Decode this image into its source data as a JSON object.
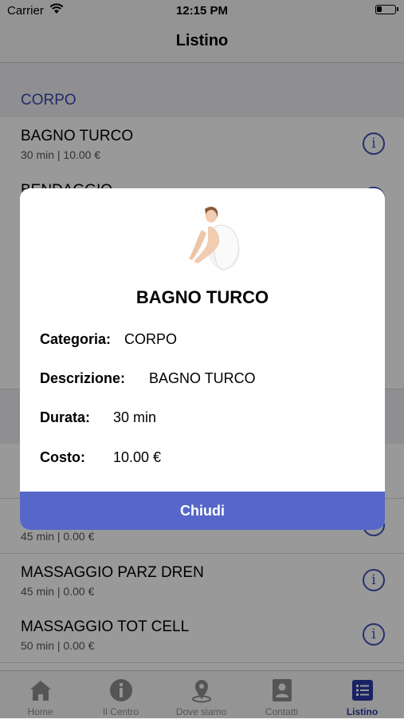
{
  "status_bar": {
    "carrier": "Carrier",
    "time": "12:15 PM"
  },
  "navbar": {
    "title": "Listino"
  },
  "section": {
    "title": "CORPO"
  },
  "rows": [
    {
      "name": "BAGNO TURCO",
      "sub": "30 min | 10.00 €"
    },
    {
      "name": "BENDAGGIO",
      "sub": ""
    },
    {
      "name": "",
      "sub": "45 min | 0.00 €"
    },
    {
      "name": "MASSAGGIO PARZ DREN",
      "sub": "45 min | 0.00 €"
    },
    {
      "name": "MASSAGGIO TOT CELL",
      "sub": "50 min | 0.00 €"
    }
  ],
  "tabs": [
    {
      "label": "Home",
      "icon": "home-icon"
    },
    {
      "label": "Il Centro",
      "icon": "info-icon"
    },
    {
      "label": "Dove siamo",
      "icon": "map-pin-icon"
    },
    {
      "label": "Contatti",
      "icon": "contact-card-icon"
    },
    {
      "label": "Listino",
      "icon": "list-icon"
    }
  ],
  "dialog": {
    "title": "BAGNO TURCO",
    "categoria_label": "Categoria:",
    "categoria_value": "CORPO",
    "descrizione_label": "Descrizione:",
    "descrizione_value": "BAGNO TURCO",
    "durata_label": "Durata:",
    "durata_value": "30 min",
    "costo_label": "Costo:",
    "costo_value": "10.00 €",
    "close_label": "Chiudi"
  },
  "colors": {
    "accent": "#3f51b5",
    "close_button": "#5667c9"
  }
}
